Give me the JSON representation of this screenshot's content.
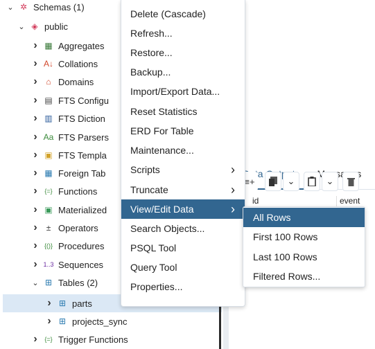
{
  "tree": {
    "items": [
      {
        "label": "Schemas (1)",
        "icon": "schemas-icon",
        "expanded": true
      },
      {
        "label": "public",
        "icon": "schema-icon",
        "expanded": true
      },
      {
        "label": "Aggregates",
        "icon": "aggregates-icon",
        "expanded": false
      },
      {
        "label": "Collations",
        "icon": "collations-icon",
        "expanded": false
      },
      {
        "label": "Domains",
        "icon": "domains-icon",
        "expanded": false
      },
      {
        "label": "FTS Configu",
        "icon": "fts-config-icon",
        "expanded": false
      },
      {
        "label": "FTS Diction",
        "icon": "fts-dictionary-icon",
        "expanded": false
      },
      {
        "label": "FTS Parsers",
        "icon": "fts-parser-icon",
        "expanded": false
      },
      {
        "label": "FTS Templa",
        "icon": "fts-template-icon",
        "expanded": false
      },
      {
        "label": "Foreign Tab",
        "icon": "foreign-table-icon",
        "expanded": false
      },
      {
        "label": "Functions",
        "icon": "functions-icon",
        "expanded": false
      },
      {
        "label": "Materialized",
        "icon": "materialized-view-icon",
        "expanded": false
      },
      {
        "label": "Operators",
        "icon": "operators-icon",
        "expanded": false
      },
      {
        "label": "Procedures",
        "icon": "procedures-icon",
        "expanded": false
      },
      {
        "label": "Sequences",
        "icon": "sequences-icon",
        "expanded": false
      },
      {
        "label": "Tables (2)",
        "icon": "tables-icon",
        "expanded": true
      },
      {
        "label": "parts",
        "icon": "table-icon",
        "expanded": false,
        "selected": true
      },
      {
        "label": "projects_sync",
        "icon": "table-icon",
        "expanded": false
      },
      {
        "label": "Trigger Functions",
        "icon": "trigger-functions-icon",
        "expanded": false
      }
    ]
  },
  "result_panel": {
    "tabs": [
      "Data Output",
      "Messages"
    ],
    "active_tab": "Data Output",
    "grid_columns": [
      "id",
      "event"
    ]
  },
  "context_menu": {
    "items": [
      {
        "label": "Delete (Cascade)",
        "submenu": false
      },
      {
        "label": "Refresh...",
        "submenu": false
      },
      {
        "label": "Restore...",
        "submenu": false
      },
      {
        "label": "Backup...",
        "submenu": false
      },
      {
        "label": "Import/Export Data...",
        "submenu": false
      },
      {
        "label": "Reset Statistics",
        "submenu": false
      },
      {
        "label": "ERD For Table",
        "submenu": false
      },
      {
        "label": "Maintenance...",
        "submenu": false
      },
      {
        "label": "Scripts",
        "submenu": true
      },
      {
        "label": "Truncate",
        "submenu": true
      },
      {
        "label": "View/Edit Data",
        "submenu": true,
        "active": true
      },
      {
        "label": "Search Objects...",
        "submenu": false
      },
      {
        "label": "PSQL Tool",
        "submenu": false
      },
      {
        "label": "Query Tool",
        "submenu": false
      },
      {
        "label": "Properties...",
        "submenu": false
      }
    ]
  },
  "submenu": {
    "items": [
      {
        "label": "All Rows",
        "active": true
      },
      {
        "label": "First 100 Rows"
      },
      {
        "label": "Last 100 Rows"
      },
      {
        "label": "Filtered Rows..."
      }
    ]
  },
  "colors": {
    "accent": "#326690",
    "selection": "#dbe8f5"
  }
}
